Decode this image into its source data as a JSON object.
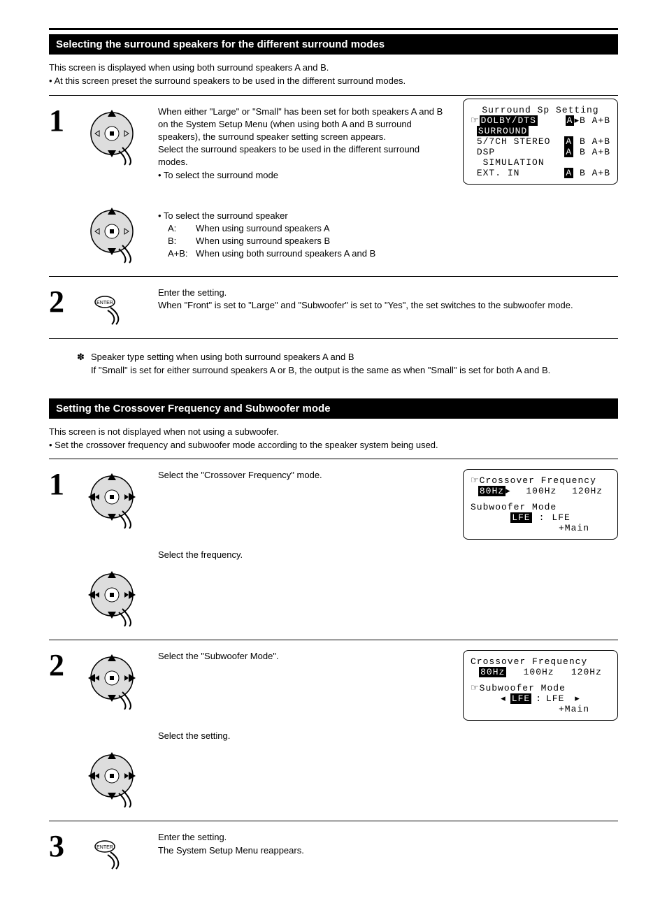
{
  "section1": {
    "title": "Selecting the surround speakers for the different surround modes",
    "intro_line1": "This screen is displayed when using both surround speakers A and B.",
    "intro_line2": "• At this screen preset the surround speakers to be used in the different surround modes.",
    "step1": {
      "p1": "When either \"Large\" or \"Small\" has been set for both speakers A and B on the System Setup Menu (when using both A and B surround speakers), the surround speaker setting screen appears.",
      "p2": "Select the surround speakers to be used in the different surround modes.",
      "b1": "• To select the surround mode",
      "b2": "• To select the surround speaker",
      "optA_l": "A:",
      "optA_t": "When using surround speakers A",
      "optB_l": "B:",
      "optB_t": "When using surround speakers B",
      "optAB_l": "A+B:",
      "optAB_t": "When using both surround speakers A and B"
    },
    "step2": {
      "l1": "Enter the setting.",
      "l2": "When \"Front\" is set to \"Large\" and \"Subwoofer\" is set to \"Yes\", the set switches to the subwoofer mode."
    },
    "note_sym": "✽",
    "note_l1": "Speaker type setting when using both surround speakers A and B",
    "note_l2": "If \"Small\" is set for either surround speakers A or B, the output is the same as when \"Small\" is set for both A and B.",
    "osd": {
      "title": "Surround Sp Setting",
      "r1a": "DOLBY/DTS",
      "r1b": "A",
      "r1c": "B A+B",
      "r1s": "SURROUND",
      "r2a": "5/7CH STEREO",
      "r2b": "A",
      "r2c": "B A+B",
      "r3a": "DSP",
      "r3b": "A",
      "r3c": "B A+B",
      "r3s": "SIMULATION",
      "r4a": "EXT. IN",
      "r4b": "A",
      "r4c": "B A+B"
    }
  },
  "section2": {
    "title": "Setting the Crossover Frequency and Subwoofer mode",
    "intro_line1": "This screen is not displayed when not using a subwoofer.",
    "intro_line2": "• Set the crossover frequency and subwoofer mode according to the speaker system being used.",
    "step1a": "Select the \"Crossover Frequency\" mode.",
    "step1b": "Select the frequency.",
    "step2a": "Select the \"Subwoofer Mode\".",
    "step2b": "Select the setting.",
    "step3a": "Enter the setting.",
    "step3b": "The System Setup Menu reappears.",
    "osd1": {
      "t1": "Crossover Frequency",
      "f1": "80Hz",
      "f2": "100Hz",
      "f3": "120Hz",
      "t2": "Subwoofer Mode",
      "m1": "LFE",
      "m2": "LFE",
      "m3": "+Main"
    },
    "osd2": {
      "t1": "Crossover Frequency",
      "f1": "80Hz",
      "f2": "100Hz",
      "f3": "120Hz",
      "t2": "Subwoofer Mode",
      "m1": "LFE",
      "m2": "LFE",
      "m3": "+Main"
    }
  }
}
